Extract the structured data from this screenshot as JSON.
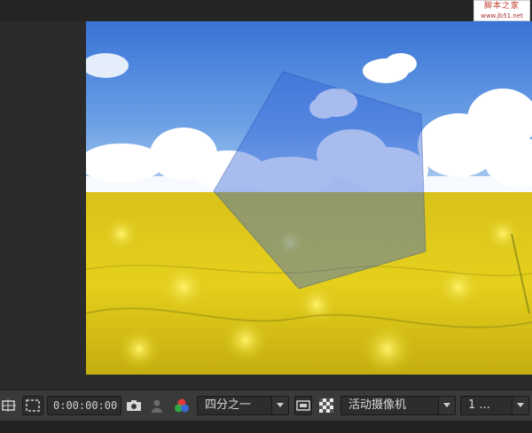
{
  "watermark": {
    "title": "脚本之家",
    "url": "www.jb51.net"
  },
  "toolbar": {
    "timecode": "0:00:00:00",
    "resolution": "四分之一",
    "camera": "活动摄像机",
    "views": "1 ..."
  },
  "colors": {
    "panel": "#3a3a3a",
    "background": "#2b2b2b",
    "field": "#2d2d2d",
    "text": "#d8d8d8"
  },
  "icons": [
    "region-of-interest-icon",
    "transparency-grid-toggle-icon",
    "snapshot-camera-icon",
    "show-snapshot-icon",
    "color-channels-icon",
    "fast-previews-icon",
    "checkerboard-icon"
  ]
}
